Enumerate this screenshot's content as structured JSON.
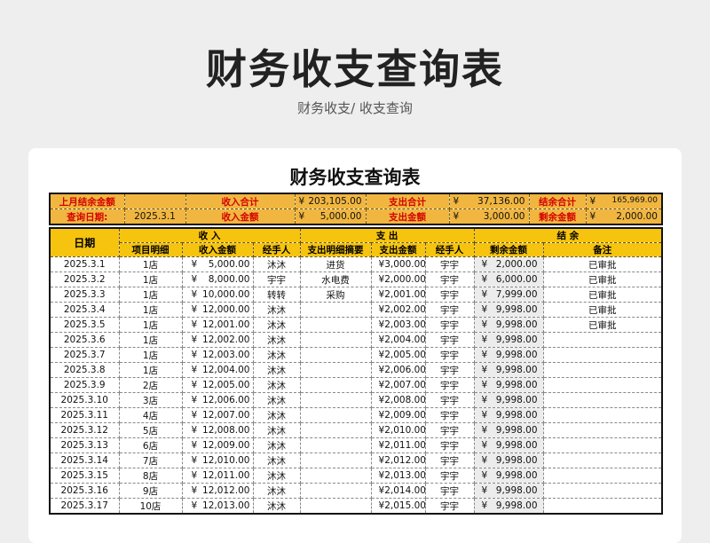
{
  "page_title": "财务收支查询表",
  "breadcrumb": "财务收支/  收支查询",
  "sheet_title": "财务收支查询表",
  "summary": {
    "last_month_label": "上月结余金额",
    "income_total_label": "收入合计",
    "income_total": "203,105.00",
    "expense_total_label": "支出合计",
    "expense_total": "37,136.00",
    "balance_total_label": "结余合计",
    "balance_total": "165,969.00",
    "query_date_label": "查询日期:",
    "query_date": "2025.3.1",
    "income_amount_label": "收入金额",
    "income_amount": "5,000.00",
    "expense_amount_label": "支出金额",
    "expense_amount": "3,000.00",
    "remaining_label": "剩余金额",
    "remaining_amount": "2,000.00",
    "currency": "¥"
  },
  "headers": {
    "date": "日期",
    "income_group": "收  入",
    "expense_group": "支  出",
    "balance_group": "结  余",
    "item_detail": "项目明细",
    "income_amount": "收入金额",
    "handler": "经手人",
    "expense_detail": "支出明细摘要",
    "expense_amount": "支出金额",
    "handler2": "经手人",
    "remaining": "剩余金额",
    "remark": "备注"
  },
  "rows": [
    {
      "date": "2025.3.1",
      "item": "1店",
      "income": "5,000.00",
      "handler": "沐沐",
      "exp_detail": "进货",
      "expense": "3,000.00",
      "handler2": "宇宇",
      "balance": "2,000.00",
      "remark": "已审批"
    },
    {
      "date": "2025.3.2",
      "item": "1店",
      "income": "8,000.00",
      "handler": "宇宇",
      "exp_detail": "水电费",
      "expense": "2,000.00",
      "handler2": "宇宇",
      "balance": "6,000.00",
      "remark": "已审批"
    },
    {
      "date": "2025.3.3",
      "item": "1店",
      "income": "10,000.00",
      "handler": "转转",
      "exp_detail": "采购",
      "expense": "2,001.00",
      "handler2": "宇宇",
      "balance": "7,999.00",
      "remark": "已审批"
    },
    {
      "date": "2025.3.4",
      "item": "1店",
      "income": "12,000.00",
      "handler": "沐沐",
      "exp_detail": "",
      "expense": "2,002.00",
      "handler2": "宇宇",
      "balance": "9,998.00",
      "remark": "已审批"
    },
    {
      "date": "2025.3.5",
      "item": "1店",
      "income": "12,001.00",
      "handler": "沐沐",
      "exp_detail": "",
      "expense": "2,003.00",
      "handler2": "宇宇",
      "balance": "9,998.00",
      "remark": "已审批"
    },
    {
      "date": "2025.3.6",
      "item": "1店",
      "income": "12,002.00",
      "handler": "沐沐",
      "exp_detail": "",
      "expense": "2,004.00",
      "handler2": "宇宇",
      "balance": "9,998.00",
      "remark": ""
    },
    {
      "date": "2025.3.7",
      "item": "1店",
      "income": "12,003.00",
      "handler": "沐沐",
      "exp_detail": "",
      "expense": "2,005.00",
      "handler2": "宇宇",
      "balance": "9,998.00",
      "remark": ""
    },
    {
      "date": "2025.3.8",
      "item": "1店",
      "income": "12,004.00",
      "handler": "沐沐",
      "exp_detail": "",
      "expense": "2,006.00",
      "handler2": "宇宇",
      "balance": "9,998.00",
      "remark": ""
    },
    {
      "date": "2025.3.9",
      "item": "2店",
      "income": "12,005.00",
      "handler": "沐沐",
      "exp_detail": "",
      "expense": "2,007.00",
      "handler2": "宇宇",
      "balance": "9,998.00",
      "remark": ""
    },
    {
      "date": "2025.3.10",
      "item": "3店",
      "income": "12,006.00",
      "handler": "沐沐",
      "exp_detail": "",
      "expense": "2,008.00",
      "handler2": "宇宇",
      "balance": "9,998.00",
      "remark": ""
    },
    {
      "date": "2025.3.11",
      "item": "4店",
      "income": "12,007.00",
      "handler": "沐沐",
      "exp_detail": "",
      "expense": "2,009.00",
      "handler2": "宇宇",
      "balance": "9,998.00",
      "remark": ""
    },
    {
      "date": "2025.3.12",
      "item": "5店",
      "income": "12,008.00",
      "handler": "沐沐",
      "exp_detail": "",
      "expense": "2,010.00",
      "handler2": "宇宇",
      "balance": "9,998.00",
      "remark": ""
    },
    {
      "date": "2025.3.13",
      "item": "6店",
      "income": "12,009.00",
      "handler": "沐沐",
      "exp_detail": "",
      "expense": "2,011.00",
      "handler2": "宇宇",
      "balance": "9,998.00",
      "remark": ""
    },
    {
      "date": "2025.3.14",
      "item": "7店",
      "income": "12,010.00",
      "handler": "沐沐",
      "exp_detail": "",
      "expense": "2,012.00",
      "handler2": "宇宇",
      "balance": "9,998.00",
      "remark": ""
    },
    {
      "date": "2025.3.15",
      "item": "8店",
      "income": "12,011.00",
      "handler": "沐沐",
      "exp_detail": "",
      "expense": "2,013.00",
      "handler2": "宇宇",
      "balance": "9,998.00",
      "remark": ""
    },
    {
      "date": "2025.3.16",
      "item": "9店",
      "income": "12,012.00",
      "handler": "沐沐",
      "exp_detail": "",
      "expense": "2,014.00",
      "handler2": "宇宇",
      "balance": "9,998.00",
      "remark": ""
    },
    {
      "date": "2025.3.17",
      "item": "10店",
      "income": "12,013.00",
      "handler": "沐沐",
      "exp_detail": "",
      "expense": "2,015.00",
      "handler2": "宇宇",
      "balance": "9,998.00",
      "remark": ""
    }
  ],
  "colors": {
    "summary_bg": "#f0b640",
    "header_bg": "#f6c40e",
    "label_red": "#d40000",
    "balance_bg": "#ececec"
  }
}
